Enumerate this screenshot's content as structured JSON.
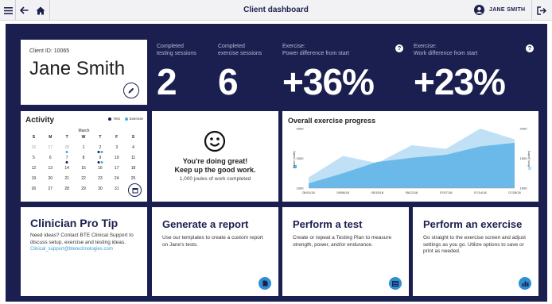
{
  "app": {
    "title": "Client dashboard",
    "user_name": "JANE SMITH"
  },
  "client": {
    "id_label": "Client ID: 10065",
    "name": "Jane Smith"
  },
  "stats": [
    {
      "label_line1": "Completed",
      "label_line2": "testing sessions",
      "value": "2",
      "help": false
    },
    {
      "label_line1": "Completed",
      "label_line2": "exercise sessions",
      "value": "6",
      "help": false
    },
    {
      "label_line1": "Exercise:",
      "label_line2": "Power difference from start",
      "value": "+36%",
      "help": true
    },
    {
      "label_line1": "Exercise:",
      "label_line2": "Work difference from start",
      "value": "+23%",
      "help": true
    }
  ],
  "activity": {
    "title": "Activity",
    "legend": [
      {
        "label": "Test",
        "color": "#1b1f4f"
      },
      {
        "label": "Exercise",
        "color": "#45a9e1"
      }
    ],
    "month": "March",
    "weekdays": [
      "S",
      "M",
      "T",
      "W",
      "T",
      "F",
      "S"
    ],
    "weeks": [
      [
        {
          "d": "26",
          "dim": true
        },
        {
          "d": "27",
          "dim": true
        },
        {
          "d": "28",
          "dim": true,
          "ex": 1
        },
        {
          "d": "1"
        },
        {
          "d": "2",
          "test": 1,
          "ex": 1
        },
        {
          "d": "3"
        },
        {
          "d": "4"
        }
      ],
      [
        {
          "d": "5"
        },
        {
          "d": "6"
        },
        {
          "d": "7",
          "test": 1
        },
        {
          "d": "8"
        },
        {
          "d": "9",
          "test": 1,
          "ex": 1
        },
        {
          "d": "10"
        },
        {
          "d": "11"
        }
      ],
      [
        {
          "d": "12"
        },
        {
          "d": "13"
        },
        {
          "d": "14"
        },
        {
          "d": "15"
        },
        {
          "d": "16"
        },
        {
          "d": "17"
        },
        {
          "d": "18"
        }
      ],
      [
        {
          "d": "19"
        },
        {
          "d": "20"
        },
        {
          "d": "21"
        },
        {
          "d": "22"
        },
        {
          "d": "23"
        },
        {
          "d": "24"
        },
        {
          "d": "25"
        }
      ],
      [
        {
          "d": "26"
        },
        {
          "d": "27"
        },
        {
          "d": "28"
        },
        {
          "d": "29"
        },
        {
          "d": "30"
        },
        {
          "d": "31"
        },
        {
          "d": ""
        }
      ]
    ]
  },
  "encouragement": {
    "line1": "You're doing great!",
    "line2": "Keep up the good work.",
    "detail": "1,000 joules of work completed"
  },
  "chart_data": {
    "type": "area",
    "title": "Overall exercise progress",
    "x": [
      "05/01/18",
      "05/08/18",
      "05/15/18",
      "05/22/18",
      "07/07/18",
      "07/14/18",
      "07/28/18"
    ],
    "ylabel_left": "Power (watts)",
    "ylabel_right": "Work (joules)",
    "ylim": [
      1000,
      2000
    ],
    "yticks": [
      "2000",
      "1500",
      "1000"
    ],
    "series": [
      {
        "name": "Work (joules)",
        "color": "#b9def4",
        "values": [
          1180,
          1540,
          1420,
          1720,
          1660,
          2000,
          1820
        ]
      },
      {
        "name": "Power (watts)",
        "color": "#5cb1e6",
        "values": [
          1080,
          1250,
          1440,
          1510,
          1560,
          1700,
          1760
        ]
      }
    ],
    "legend_position": "sides"
  },
  "tip": {
    "title": "Clinician Pro Tip",
    "text": "Need ideas? Contact BTE Clinical Support to discuss setup, exercise and testing ideas.",
    "link": "Clinical_support@btetechnologies.com"
  },
  "actions": [
    {
      "title": "Generate a report",
      "desc": "Use our templates to create a custom report on Jane's tests.",
      "icon": "document-icon"
    },
    {
      "title": "Perform a test",
      "desc": "Create or repeat a Testing Plan to measure strength, power, and/or endurance.",
      "icon": "list-icon"
    },
    {
      "title": "Perform an exercise",
      "desc": "Go straight to the exercise screen and adjust settings as you go. Utilize options to save or print as needed.",
      "icon": "chart-icon"
    }
  ]
}
